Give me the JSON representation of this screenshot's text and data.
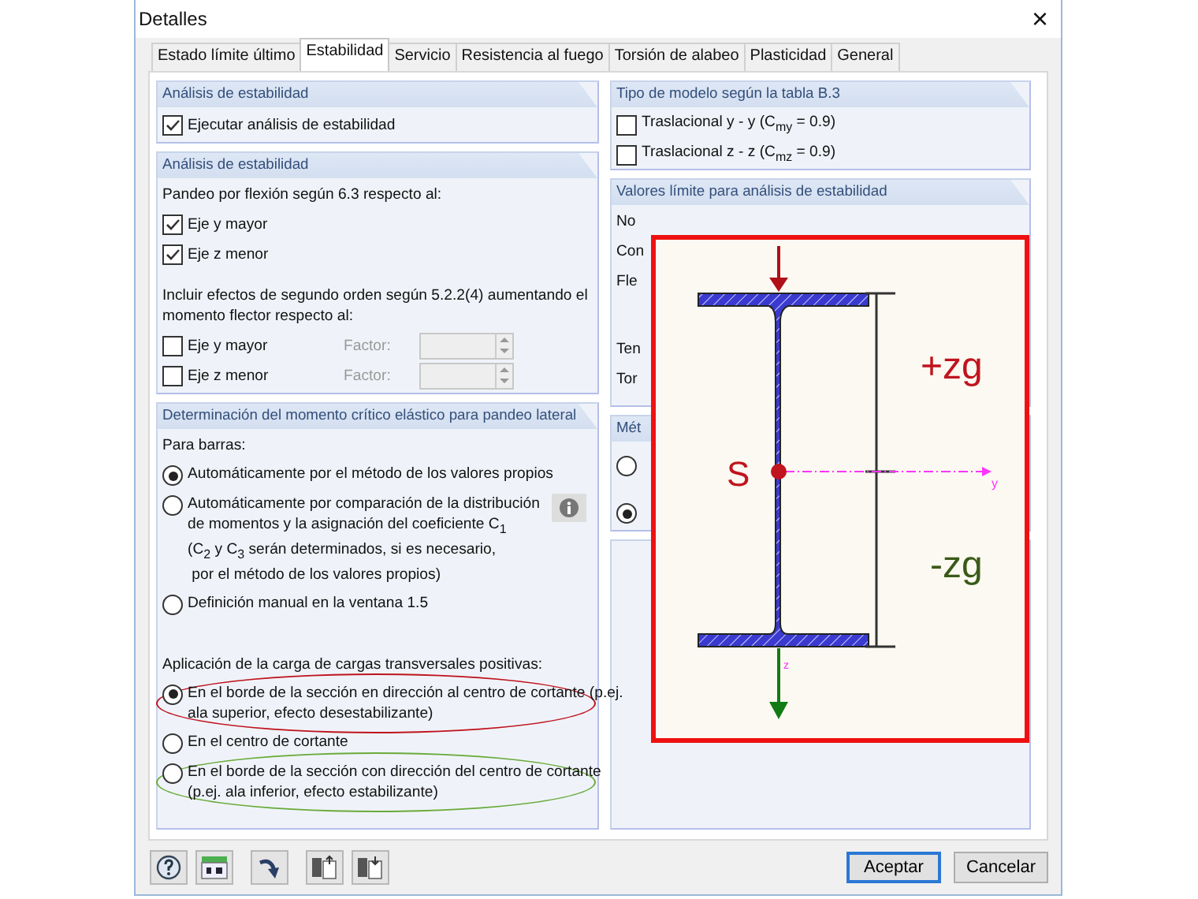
{
  "window": {
    "title": "Detalles",
    "close": "×"
  },
  "tabs": [
    {
      "label": "Estado límite último",
      "selected": false
    },
    {
      "label": "Estabilidad",
      "selected": true
    },
    {
      "label": "Servicio",
      "selected": false
    },
    {
      "label": "Resistencia al fuego",
      "selected": false
    },
    {
      "label": "Torsión de alabeo",
      "selected": false
    },
    {
      "label": "Plasticidad",
      "selected": false
    },
    {
      "label": "General",
      "selected": false
    }
  ],
  "left_groups": [
    {
      "title": "Análisis de estabilidad",
      "items": [
        {
          "kind": "checkbox",
          "label": "Ejecutar análisis de estabilidad",
          "checked": true
        }
      ]
    },
    {
      "title": "Análisis de estabilidad",
      "items": [
        {
          "kind": "text",
          "label": "Pandeo por flexión según 6.3 respecto al:"
        },
        {
          "kind": "checkbox",
          "label": "Eje y mayor",
          "checked": true
        },
        {
          "kind": "checkbox",
          "label": "Eje z menor",
          "checked": true
        },
        {
          "kind": "text",
          "label": "Incluir efectos de segundo orden según 5.2.2(4) aumentando el momento flector respecto al:"
        },
        {
          "kind": "factor",
          "label": "Eje y mayor",
          "checked": false,
          "factor_label": "Factor:"
        },
        {
          "kind": "factor",
          "label": "Eje z menor",
          "checked": false,
          "factor_label": "Factor:"
        }
      ]
    },
    {
      "title": "Determinación del momento crítico elástico para pandeo lateral",
      "items": [
        {
          "kind": "text",
          "label": "Para barras:"
        },
        {
          "kind": "radio",
          "label": "Automáticamente por el método de los valores propios",
          "selected": true
        },
        {
          "kind": "radio",
          "label": "Automáticamente por comparación de la distribución\nde momentos y la asignación del coeficiente C$_{1}$\n(C$_{2}$ y C$_{3}$ serán determinados, si es necesario,\n por el método de los valores propios)",
          "selected": false,
          "info": true
        },
        {
          "kind": "radio",
          "label": "Definición manual en la ventana 1.5",
          "selected": false
        },
        {
          "kind": "text",
          "label": "Aplicación de la carga de cargas transversales positivas:"
        },
        {
          "kind": "radio",
          "label": "En el borde de la sección en dirección al centro de cortante (p.ej.\nala superior, efecto desestabilizante)",
          "selected": true,
          "color": "#c0141e"
        },
        {
          "kind": "radio",
          "label": "En el centro de cortante",
          "selected": false
        },
        {
          "kind": "radio",
          "label": "En el borde de la sección con dirección del centro de cortante\n(p.ej. ala inferior, efecto estabilizante)",
          "selected": false,
          "color": "#6aaa3a"
        }
      ]
    }
  ],
  "right_groups": [
    {
      "title": "Tipo de modelo según la tabla B.3",
      "items": [
        {
          "kind": "checkbox",
          "label": "Traslacional y - y (C$_{my}$ = 0.9)",
          "checked": false
        },
        {
          "kind": "checkbox",
          "label": "Traslacional z - z (C$_{mz}$ = 0.9)",
          "checked": false
        }
      ]
    },
    {
      "title": "Valores límite para análisis de estabilidad",
      "items": [
        {
          "kind": "text",
          "label": "No"
        },
        {
          "kind": "text",
          "label": "Con"
        },
        {
          "kind": "text",
          "label": "Fle"
        },
        {
          "kind": "gap"
        },
        {
          "kind": "text",
          "label": "Ten"
        },
        {
          "kind": "text",
          "label": "Tor"
        }
      ]
    },
    {
      "title": "Mét",
      "items": [
        {
          "kind": "radio",
          "selected": false
        },
        {
          "kind": "radio",
          "selected": true
        }
      ]
    },
    {
      "kind": "empty"
    }
  ],
  "figure": {
    "upper_label": "+zg",
    "lower_label": "-zg",
    "center_label": "S",
    "y_axis": "y",
    "z_axis": "z"
  },
  "footer": {
    "tool_buttons": [
      {
        "kind": "help"
      },
      {
        "kind": "units"
      },
      {
        "kind": "jump"
      },
      {
        "kind": "export"
      },
      {
        "kind": "import"
      }
    ],
    "buttons": [
      {
        "label": "Aceptar",
        "default": true
      },
      {
        "label": "Cancelar",
        "default": false
      }
    ]
  }
}
